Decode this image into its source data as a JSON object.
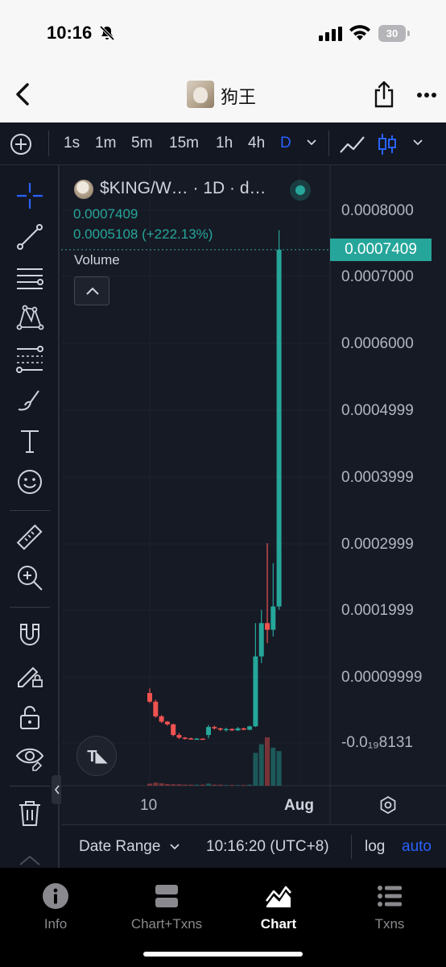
{
  "status_bar": {
    "time": "10:16",
    "battery": "30"
  },
  "header": {
    "title": "狗王"
  },
  "timeframes": [
    "1s",
    "1m",
    "5m",
    "15m",
    "1h",
    "4h",
    "D"
  ],
  "timeframe_active": "D",
  "legend": {
    "title": "$KING/W… · 1D · d…",
    "price": "0.0007409",
    "change": "0.0005108 (+222.13%)",
    "volume": "Volume"
  },
  "y_axis": [
    "0.0008000",
    "0.0007000",
    "0.0006000",
    "0.0004999",
    "0.0003999",
    "0.0002999",
    "0.0001999",
    "0.00009999",
    "-0.0₁₉8131"
  ],
  "price_tag": "0.0007409",
  "x_axis": {
    "label_10": "10",
    "label_aug": "Aug"
  },
  "footer": {
    "date_range": "Date Range",
    "clock": "10:16:20 (UTC+8)",
    "log": "log",
    "auto": "auto"
  },
  "nav": {
    "info": "Info",
    "chart_txns": "Chart+Txns",
    "chart": "Chart",
    "txns": "Txns"
  },
  "colors": {
    "up": "#26a69a",
    "down": "#ef5350",
    "accent": "#2962ff",
    "background": "#131722"
  },
  "chart_data": {
    "type": "candlestick",
    "y_axis_labels": [
      "0.0008000",
      "0.0007000",
      "0.0006000",
      "0.0004999",
      "0.0003999",
      "0.0002999",
      "0.0001999",
      "0.00009999",
      "-0.0₁₉8131"
    ],
    "x_axis_labels": [
      "10",
      "Aug"
    ],
    "last_price": 0.0007409,
    "change": "0.0005108 (+222.13%)",
    "candles": [
      {
        "o": 7.5e-05,
        "h": 8.2e-05,
        "l": 6e-05,
        "c": 6.2e-05
      },
      {
        "o": 6.2e-05,
        "h": 6.5e-05,
        "l": 3.8e-05,
        "c": 4e-05
      },
      {
        "o": 4e-05,
        "h": 4.2e-05,
        "l": 3e-05,
        "c": 3.2e-05
      },
      {
        "o": 3.2e-05,
        "h": 3.3e-05,
        "l": 2.6e-05,
        "c": 2.8e-05
      },
      {
        "o": 2.8e-05,
        "h": 2.9e-05,
        "l": 1e-05,
        "c": 1.2e-05
      },
      {
        "o": 1.2e-05,
        "h": 1.5e-05,
        "l": 6e-06,
        "c": 8e-06
      },
      {
        "o": 8e-06,
        "h": 9e-06,
        "l": 5e-06,
        "c": 7e-06
      },
      {
        "o": 7e-06,
        "h": 8e-06,
        "l": 5e-06,
        "c": 6e-06
      },
      {
        "o": 6e-06,
        "h": 7.5e-06,
        "l": 5.5e-06,
        "c": 6.5e-06
      },
      {
        "o": 6.5e-06,
        "h": 7e-06,
        "l": 5.5e-06,
        "c": 6e-06
      },
      {
        "o": 1.2e-05,
        "h": 2.7e-05,
        "l": 7e-06,
        "c": 2.4e-05
      },
      {
        "o": 2.4e-05,
        "h": 2.6e-05,
        "l": 2e-05,
        "c": 2.2e-05
      },
      {
        "o": 2.2e-05,
        "h": 2.3e-05,
        "l": 1.8e-05,
        "c": 2e-05
      },
      {
        "o": 2e-05,
        "h": 2.3e-05,
        "l": 1.7e-05,
        "c": 2.1e-05
      },
      {
        "o": 2.1e-05,
        "h": 2.2e-05,
        "l": 1.8e-05,
        "c": 1.9e-05
      },
      {
        "o": 1.9e-05,
        "h": 2.4e-05,
        "l": 1.8e-05,
        "c": 2.2e-05
      },
      {
        "o": 2.2e-05,
        "h": 2.3e-05,
        "l": 1.9e-05,
        "c": 2e-05
      },
      {
        "o": 2e-05,
        "h": 2.6e-05,
        "l": 1.9e-05,
        "c": 2.5e-05
      },
      {
        "o": 2.5e-05,
        "h": 0.00018,
        "l": 2.4e-05,
        "c": 0.00013
      },
      {
        "o": 0.00013,
        "h": 0.0002,
        "l": 0.00012,
        "c": 0.00018
      },
      {
        "o": 0.00018,
        "h": 0.0003,
        "l": 0.00015,
        "c": 0.00017
      },
      {
        "o": 0.00017,
        "h": 0.00027,
        "l": 0.00016,
        "c": 0.000205
      },
      {
        "o": 0.000205,
        "h": 0.00077,
        "l": 0.0002,
        "c": 0.0007409
      }
    ],
    "volume": [
      6,
      9,
      7,
      5,
      4,
      4,
      3,
      3,
      3,
      3,
      6,
      3,
      3,
      2,
      2,
      2,
      2,
      3,
      95,
      120,
      140,
      110,
      100
    ]
  }
}
